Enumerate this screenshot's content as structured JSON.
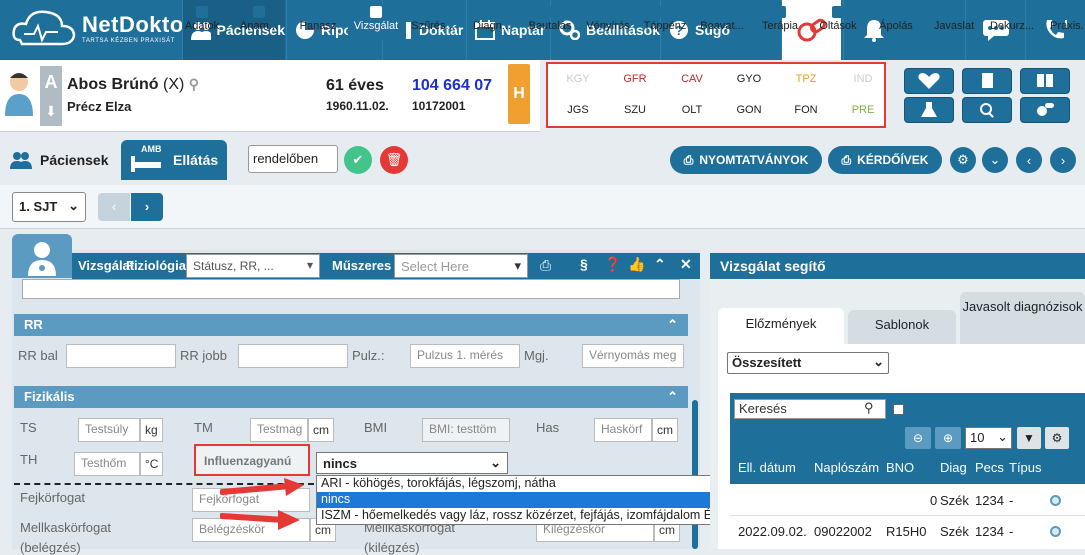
{
  "topnav": {
    "logo": {
      "name": "NetDoktor",
      "tagline": "TARTSA KÉZBEN PRAXISÁT"
    },
    "items": [
      {
        "label": "Páciensek",
        "icon": "users-icon"
      },
      {
        "label": "Riportok",
        "icon": "chart-icon"
      },
      {
        "label": "Doktár",
        "icon": "books-icon"
      },
      {
        "label": "Naptár",
        "icon": "calendar-icon"
      },
      {
        "label": "Beállítások",
        "icon": "gears-icon"
      },
      {
        "label": "Súgó",
        "icon": "help-icon"
      }
    ]
  },
  "patient": {
    "name": "Abos Brúnó",
    "suffix": "(X)",
    "mother": "Précz Elza",
    "age": "61 éves",
    "birthdate": "1960.11.02.",
    "taj": "104 664 07",
    "id2": "10172001",
    "badge": "H",
    "letter": "A"
  },
  "risk": {
    "row1": [
      {
        "code": "KGY",
        "color": "#cccccc"
      },
      {
        "code": "GFR",
        "color": "#c62828"
      },
      {
        "code": "CAV",
        "color": "#c62828"
      },
      {
        "code": "GYO",
        "color": "#222222"
      },
      {
        "code": "TPZ",
        "color": "#e6a020"
      },
      {
        "code": "IND",
        "color": "#cccccc"
      }
    ],
    "row2": [
      {
        "code": "JGS",
        "color": "#222222"
      },
      {
        "code": "SZU",
        "color": "#222222"
      },
      {
        "code": "OLT",
        "color": "#222222"
      },
      {
        "code": "GON",
        "color": "#222222"
      },
      {
        "code": "FON",
        "color": "#222222"
      },
      {
        "code": "PRE",
        "color": "#7cb342"
      }
    ]
  },
  "tabs": {
    "patients": "Páciensek",
    "care": "Ellátás",
    "amb": "AMB",
    "mode_select": "rendelőben",
    "print_btn": "NYOMTATVÁNYOK",
    "forms_btn": "KÉRDŐÍVEK"
  },
  "toolbar": {
    "sjt": "1. SJT",
    "items": [
      "Adatok",
      "Anam...",
      "Panasz",
      "Vizsgálat",
      "Szűrés...",
      "Diagn...",
      "Beutalás",
      "Vényírás",
      "Táppénz",
      "Beavat...",
      "Terápia",
      "Oltások",
      "Ápolás",
      "Javaslat",
      "Dekurz...",
      "Praxis..."
    ]
  },
  "exam": {
    "title": "Vizsgálat",
    "fiziologia": "Fiziológia",
    "status_select": "Státusz, RR, ...",
    "muszeres": "Műszeres",
    "select_placeholder": "Select Here",
    "rr_header": "RR",
    "rr_bal": "RR bal",
    "rr_jobb": "RR jobb",
    "pulz": "Pulz.:",
    "pulz_placeholder": "Pulzus 1. mérés",
    "mgj": "Mgj.",
    "mgj_placeholder": "Vérnyomás meg",
    "fizikalis_header": "Fizikális",
    "ts": "TS",
    "ts_placeholder": "Testsúly",
    "ts_unit": "kg",
    "tm": "TM",
    "tm_placeholder": "Testmag",
    "tm_unit": "cm",
    "bmi": "BMI",
    "bmi_placeholder": "BMI: testtöm",
    "has": "Has",
    "has_placeholder": "Haskörf",
    "has_unit": "cm",
    "th": "TH",
    "th_placeholder": "Testhőm",
    "th_unit": "°C",
    "influenza": "Influenzagyanú",
    "influenza_value": "nincs",
    "fejkorfogat": "Fejkörfogat",
    "fejkorfogat_placeholder": "Fejkörfogat",
    "mellkas": "Mellkaskörfogat",
    "mellkas_sub": "(belégzés)",
    "mellkas_placeholder": "Belégzéskör",
    "mellkas_unit": "cm",
    "mellkas2": "Mellkaskörfogat",
    "mellkas2_sub": "(kilégzés)",
    "mellkas2_placeholder": "Kilégzéskör",
    "mellkas2_unit": "cm"
  },
  "dropdown": {
    "options": [
      "ARI - köhögés, torokfájás, légszomj, nátha",
      "nincs",
      "ISZM - hőemelkedés vagy láz, rossz közérzet, fejfájás, izomfájdalom ÉS köhögés, torokfájás, légszomj"
    ],
    "selected_index": 1
  },
  "helper": {
    "title": "Vizsgálat segítő",
    "tab_history": "Előzmények",
    "tab_templates": "Sablonok",
    "tab_suggest": "Javasolt diagnózisok",
    "filter": "Összesített",
    "search_placeholder": "Keresés",
    "page_size": "10",
    "columns": [
      "Ell. dátum",
      "Naplószám",
      "BNO",
      "Diag",
      "Pecs",
      "Típus"
    ],
    "rows": [
      {
        "date": "",
        "log": "",
        "bno": "0",
        "diag": "Szék",
        "stamp": "1234",
        "type": "-"
      },
      {
        "date": "2022.09.02.",
        "log": "09022002",
        "bno": "R15H0",
        "diag": "Szék",
        "stamp": "1234",
        "type": "-"
      }
    ]
  },
  "colors": {
    "primary": "#1e6f9a",
    "accent_red": "#e53935",
    "orange": "#f0a030",
    "green": "#43c48a"
  }
}
